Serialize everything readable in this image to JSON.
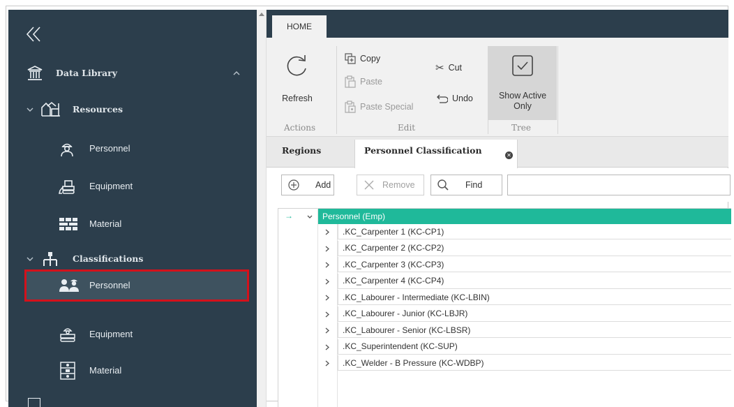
{
  "sidebar": {
    "data_library": "Data Library",
    "resources": "Resources",
    "resources_items": [
      "Personnel",
      "Equipment",
      "Material"
    ],
    "classifications": "Classifications",
    "classifications_items": [
      "Personnel",
      "Equipment",
      "Material"
    ],
    "selected_item": "Personnel"
  },
  "ribbon": {
    "tab_home": "HOME",
    "refresh": "Refresh",
    "group_actions": "Actions",
    "copy": "Copy",
    "paste": "Paste",
    "paste_special": "Paste Special",
    "cut": "Cut",
    "undo": "Undo",
    "group_edit": "Edit",
    "show_active_line1": "Show Active",
    "show_active_line2": "Only",
    "group_tree": "Tree"
  },
  "doc_tabs": {
    "regions": "Regions",
    "personnel_classification": "Personnel Classification"
  },
  "toolbar": {
    "add": "Add",
    "remove": "Remove",
    "find": "Find",
    "search_value": ""
  },
  "tree": {
    "root": "Personnel (Emp)",
    "children": [
      ".KC_Carpenter 1 (KC-CP1)",
      ".KC_Carpenter 2 (KC-CP2)",
      ".KC_Carpenter 3 (KC-CP3)",
      ".KC_Carpenter 4 (KC-CP4)",
      ".KC_Labourer - Intermediate (KC-LBIN)",
      ".KC_Labourer - Junior (KC-LBJR)",
      ".KC_Labourer - Senior (KC-LBSR)",
      ".KC_Superintendent (KC-SUP)",
      ".KC_Welder - B Pressure (KC-WDBP)"
    ]
  },
  "colors": {
    "sidebar_bg": "#2c3e4c",
    "root_row": "#1fb99a",
    "selection_border": "#d4111b"
  }
}
